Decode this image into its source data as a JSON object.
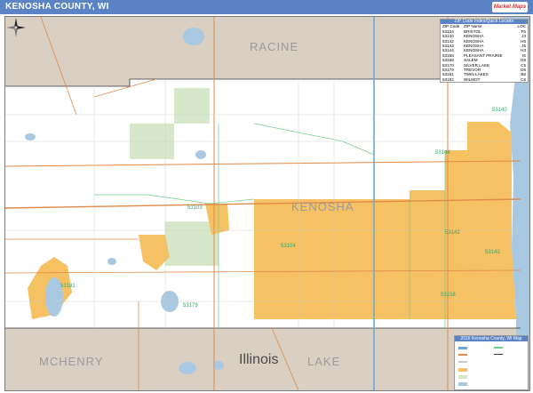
{
  "header": {
    "title": "KENOSHA COUNTY, WI",
    "logo_text": "Market Maps"
  },
  "map": {
    "county_labels": [
      "RACINE",
      "KENOSHA",
      "MCHENRY",
      "LAKE"
    ],
    "state_label": "Illinois",
    "zip_labels": [
      "53140",
      "53144",
      "53103",
      "53104",
      "53142",
      "53143",
      "53158",
      "53179",
      "53181"
    ],
    "colors": {
      "water": "#a9c9e2",
      "outside_county": "#d9cfc2",
      "urban": "#f5c162",
      "park": "#d6e8c9",
      "highway": "#e08a4a",
      "zip_boundary": "#6fcf8a",
      "county_line": "#333333",
      "title_bar": "#5b83c6"
    }
  },
  "zip_table": {
    "title": "ZIP Code Index/Quick Locator",
    "columns": [
      "ZIP Code",
      "ZIP Name",
      "LOC"
    ],
    "rows": [
      [
        "53104",
        "BRISTOL",
        "F5"
      ],
      [
        "53140",
        "KENOSHA",
        "J3"
      ],
      [
        "53142",
        "KENOSHA",
        "H5"
      ],
      [
        "53143",
        "KENOSHA",
        "J5"
      ],
      [
        "53144",
        "KENOSHA",
        "H3"
      ],
      [
        "53158",
        "PLEASANT PRAIRIE",
        "I6"
      ],
      [
        "53168",
        "SALEM",
        "D6"
      ],
      [
        "53170",
        "SILVER LAKE",
        "C5"
      ],
      [
        "53179",
        "TREVOR",
        "D6"
      ],
      [
        "53181",
        "TWIN LAKES",
        "B6"
      ],
      [
        "53192",
        "WILMOT",
        "C6"
      ]
    ]
  },
  "legend": {
    "title": "2016 Kenosha County, WI Map"
  }
}
